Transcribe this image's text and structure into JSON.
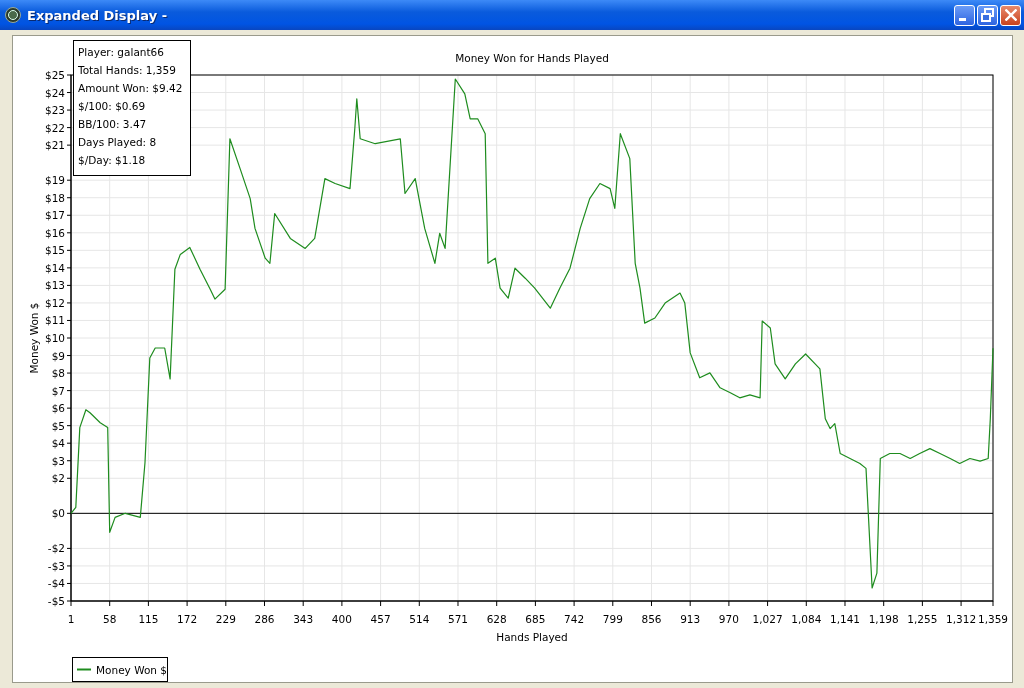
{
  "window": {
    "title": "Expanded Display -"
  },
  "chart": {
    "chart_data": {
      "type": "line",
      "title": "Money Won for Hands Played",
      "xlabel": "Hands Played",
      "ylabel": "Money Won $",
      "x": [
        1,
        8,
        14,
        23,
        29,
        44,
        55,
        58,
        66,
        81,
        103,
        110,
        117,
        125,
        139,
        147,
        154,
        162,
        176,
        191,
        206,
        213,
        228,
        235,
        250,
        265,
        272,
        287,
        294,
        301,
        324,
        346,
        360,
        375,
        390,
        412,
        419,
        422,
        427,
        449,
        486,
        493,
        508,
        522,
        537,
        544,
        552,
        567,
        581,
        589,
        600,
        611,
        615,
        626,
        633,
        645,
        655,
        670,
        684,
        707,
        721,
        736,
        751,
        765,
        780,
        795,
        802,
        810,
        824,
        832,
        839,
        846,
        861,
        876,
        898,
        905,
        913,
        927,
        942,
        957,
        972,
        986,
        1001,
        1016,
        1019,
        1031,
        1038,
        1053,
        1068,
        1083,
        1097,
        1104,
        1112,
        1119,
        1126,
        1134,
        1163,
        1172,
        1181,
        1188,
        1193,
        1207,
        1222,
        1237,
        1251,
        1266,
        1281,
        1296,
        1310,
        1325,
        1340,
        1352,
        1355,
        1359
      ],
      "series": [
        {
          "name": "Money Won $",
          "color": "#1e8c1e",
          "values": [
            0,
            0.34,
            4.89,
            5.91,
            5.74,
            5.17,
            4.89,
            -1.08,
            -0.23,
            0,
            -0.23,
            2.9,
            8.86,
            9.43,
            9.43,
            7.67,
            13.92,
            14.77,
            15.17,
            13.92,
            12.78,
            12.22,
            12.78,
            21.36,
            19.66,
            17.95,
            16.25,
            14.55,
            14.26,
            17.1,
            15.68,
            15.11,
            15.68,
            19.09,
            18.81,
            18.52,
            21.93,
            23.64,
            21.36,
            21.08,
            21.36,
            18.24,
            19.09,
            16.25,
            14.26,
            15.97,
            15.11,
            24.77,
            23.92,
            22.5,
            22.5,
            21.65,
            14.26,
            14.55,
            12.84,
            12.27,
            13.98,
            13.41,
            12.84,
            11.7,
            12.84,
            13.98,
            16.25,
            17.95,
            18.81,
            18.52,
            17.39,
            21.65,
            20.23,
            14.26,
            12.84,
            10.85,
            11.14,
            11.99,
            12.56,
            11.99,
            9.15,
            7.73,
            8.01,
            7.16,
            6.88,
            6.59,
            6.76,
            6.59,
            10.97,
            10.57,
            8.52,
            7.67,
            8.52,
            9.09,
            8.52,
            8.24,
            5.4,
            4.83,
            5.11,
            3.41,
            2.84,
            2.56,
            -4.26,
            -3.41,
            3.13,
            3.41,
            3.41,
            3.13,
            3.41,
            3.69,
            3.41,
            3.13,
            2.84,
            3.13,
            2.98,
            3.13,
            5.4,
            9.42
          ]
        }
      ],
      "xlim": [
        1,
        1359
      ],
      "ylim": [
        -5,
        25
      ],
      "xticks": [
        1,
        58,
        115,
        172,
        229,
        286,
        343,
        400,
        457,
        514,
        571,
        628,
        685,
        742,
        799,
        856,
        913,
        970,
        {
          "value": 1027,
          "label": "1,027"
        },
        {
          "value": 1084,
          "label": "1,084"
        },
        {
          "value": 1141,
          "label": "1,141"
        },
        {
          "value": 1198,
          "label": "1,198"
        },
        {
          "value": 1255,
          "label": "1,255"
        },
        {
          "value": 1312,
          "label": "1,312"
        },
        {
          "value": 1359,
          "label": "1,359"
        }
      ],
      "yticks": [
        {
          "value": 25,
          "label": "$25"
        },
        {
          "value": 24,
          "label": "$24"
        },
        {
          "value": 23,
          "label": "$23"
        },
        {
          "value": 22,
          "label": "$22"
        },
        {
          "value": 21,
          "label": "$21"
        },
        {
          "value": 19,
          "label": "$19"
        },
        {
          "value": 18,
          "label": "$18"
        },
        {
          "value": 17,
          "label": "$17"
        },
        {
          "value": 16,
          "label": "$16"
        },
        {
          "value": 15,
          "label": "$15"
        },
        {
          "value": 14,
          "label": "$14"
        },
        {
          "value": 13,
          "label": "$13"
        },
        {
          "value": 12,
          "label": "$12"
        },
        {
          "value": 11,
          "label": "$11"
        },
        {
          "value": 10,
          "label": "$10"
        },
        {
          "value": 9,
          "label": "$9"
        },
        {
          "value": 8,
          "label": "$8"
        },
        {
          "value": 7,
          "label": "$7"
        },
        {
          "value": 6,
          "label": "$6"
        },
        {
          "value": 5,
          "label": "$5"
        },
        {
          "value": 4,
          "label": "$4"
        },
        {
          "value": 3,
          "label": "$3"
        },
        {
          "value": 2,
          "label": "$2"
        },
        {
          "value": 0,
          "label": "$0"
        },
        {
          "value": -2,
          "label": "-$2"
        },
        {
          "value": -3,
          "label": "-$3"
        },
        {
          "value": -4,
          "label": "-$4"
        },
        {
          "value": -5,
          "label": "-$5"
        }
      ],
      "grid": true,
      "ref_lines": [
        {
          "axis": "y",
          "value": 0
        }
      ]
    }
  },
  "tooltip": {
    "lines": [
      "Player: galant66",
      "Total Hands: 1,359",
      "Amount Won: $9.42",
      "$/100: $0.69",
      "BB/100: 3.47",
      "Days Played: 8",
      "$/Day: $1.18"
    ]
  }
}
